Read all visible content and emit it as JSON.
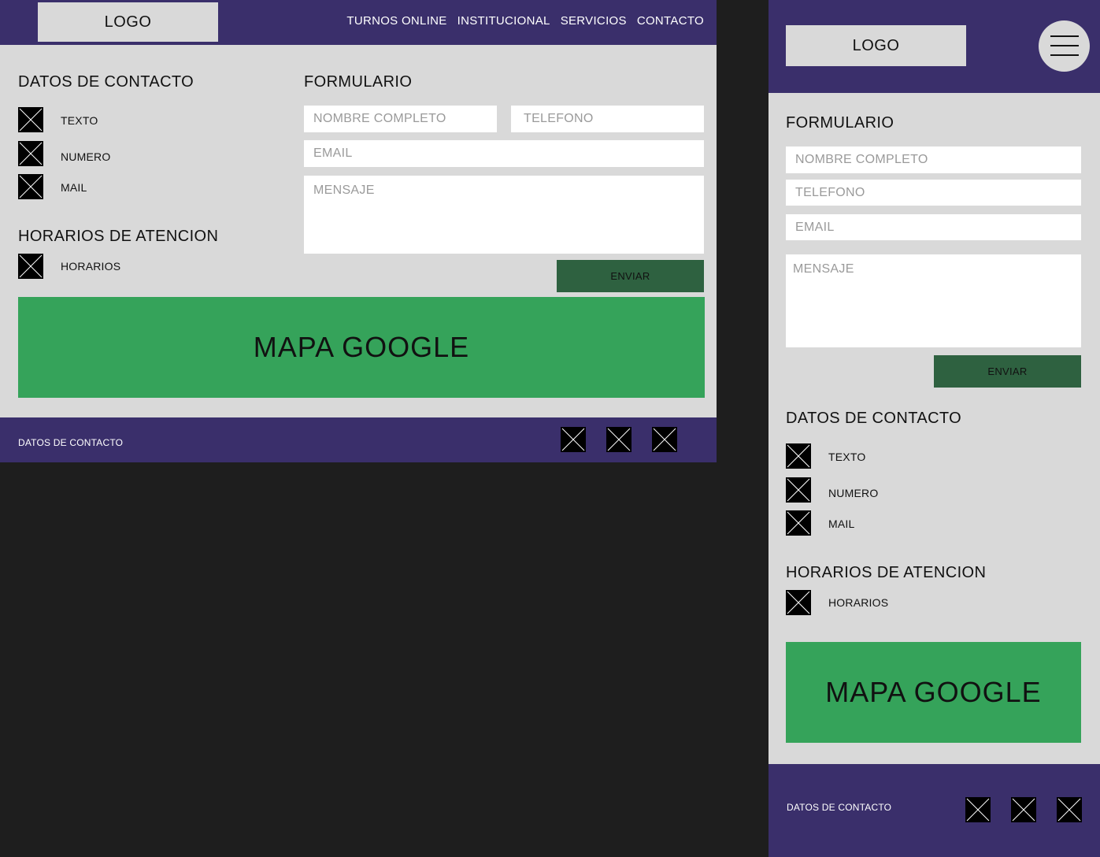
{
  "desktop": {
    "logo": "LOGO",
    "nav": [
      "TURNOS ONLINE",
      "INSTITUCIONAL",
      "SERVICIOS",
      "CONTACTO"
    ],
    "contact_title": "DATOS DE CONTACTO",
    "contact_items": [
      "TEXTO",
      "NUMERO",
      "MAIL"
    ],
    "hours_title": "HORARIOS DE ATENCION",
    "hours_item": "HORARIOS",
    "form_title": "FORMULARIO",
    "placeholders": {
      "name": "NOMBRE COMPLETO",
      "phone": "TELEFONO",
      "email": "EMAIL",
      "message": "MENSAJE"
    },
    "submit": "ENVIAR",
    "map": "MAPA GOOGLE",
    "footer_text": "DATOS DE CONTACTO"
  },
  "mobile": {
    "logo": "LOGO",
    "form_title": "FORMULARIO",
    "placeholders": {
      "name": "NOMBRE COMPLETO",
      "phone": "TELEFONO",
      "email": "EMAIL",
      "message": "MENSAJE"
    },
    "submit": "ENVIAR",
    "contact_title": "DATOS DE CONTACTO",
    "contact_items": [
      "TEXTO",
      "NUMERO",
      "MAIL"
    ],
    "hours_title": "HORARIOS DE ATENCION",
    "hours_item": "HORARIOS",
    "map": "MAPA GOOGLE",
    "footer_text": "DATOS DE CONTACTO"
  },
  "colors": {
    "header": "#3a2f6b",
    "frame": "#d9d9d9",
    "button": "#2e6140",
    "map": "#35a35a",
    "canvas": "#1e1e1e"
  }
}
